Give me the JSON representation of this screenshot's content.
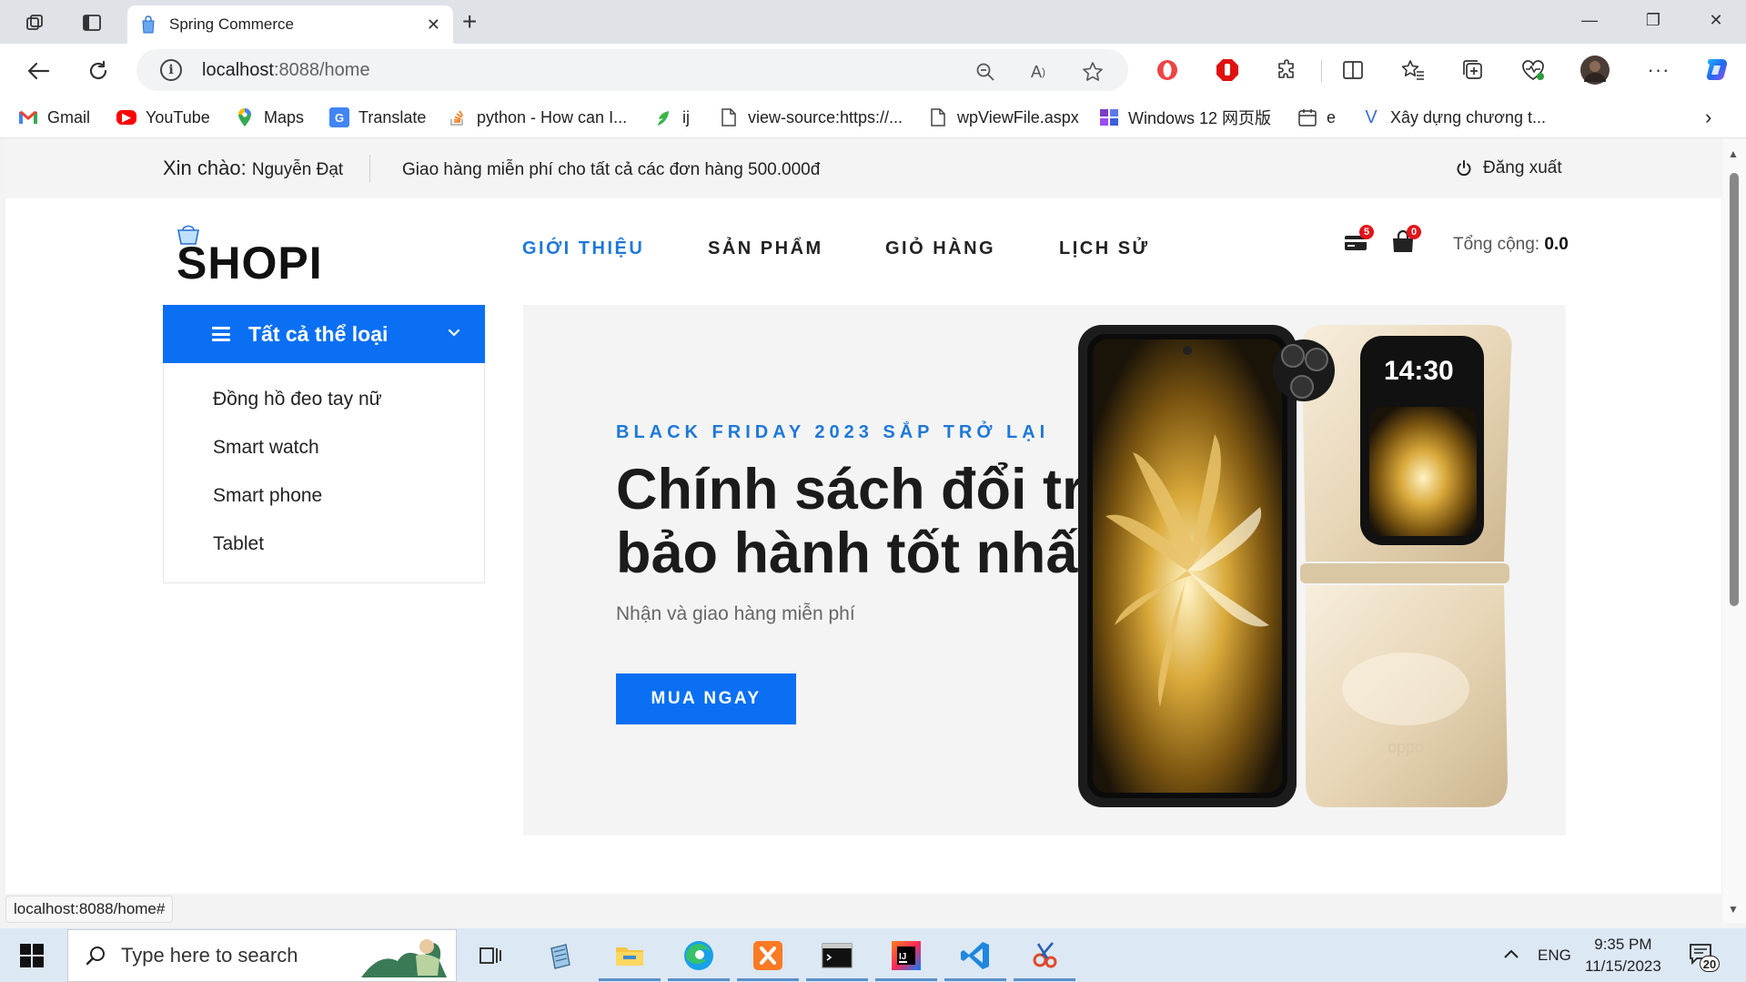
{
  "browser": {
    "tab": {
      "title": "Spring Commerce",
      "close_glyph": "✕"
    },
    "window_controls": {
      "minimize": "—",
      "maximize": "❐",
      "close": "✕"
    },
    "address": {
      "host": "localhost",
      "rest": ":8088/home"
    },
    "bookmarks": [
      {
        "label": "Gmail",
        "icon": "gmail-icon",
        "color": "#ea4335"
      },
      {
        "label": "YouTube",
        "icon": "youtube-icon",
        "color": "#ff0000"
      },
      {
        "label": "Maps",
        "icon": "maps-icon",
        "color": "#34a853"
      },
      {
        "label": "Translate",
        "icon": "translate-icon",
        "color": "#4285f4"
      },
      {
        "label": "python - How can I...",
        "icon": "stackoverflow-icon",
        "color": "#f48024"
      },
      {
        "label": "ij",
        "icon": "ij-icon",
        "color": "#3bb44a"
      },
      {
        "label": "view-source:https://...",
        "icon": "page-icon",
        "color": "#555555"
      },
      {
        "label": "wpViewFile.aspx",
        "icon": "page-icon",
        "color": "#555555"
      },
      {
        "label": "Windows 12 网页版",
        "icon": "windows12-icon",
        "color": "#7a3dc8"
      },
      {
        "label": "e",
        "icon": "calendar-icon",
        "color": "#555555"
      },
      {
        "label": "Xây dựng chương t...",
        "icon": "v-icon",
        "color": "#3b6fd6"
      }
    ]
  },
  "site": {
    "topbar": {
      "greeting_prefix": "Xin chào: ",
      "user_name": "Nguyễn Đạt",
      "shipping_note": "Giao hàng miễn phí cho tất cả các đơn hàng 500.000đ",
      "logout": "Đăng xuất"
    },
    "logo": "SHOPI",
    "nav": [
      {
        "label": "GIỚI THIỆU",
        "active": true
      },
      {
        "label": "SẢN PHẨM",
        "active": false
      },
      {
        "label": "GIỎ HÀNG",
        "active": false
      },
      {
        "label": "LỊCH SỬ",
        "active": false
      }
    ],
    "cart": {
      "card_count": "5",
      "bag_count": "0",
      "total_label": "Tổng cộng: ",
      "total_value": "0.0"
    },
    "categories": {
      "button": "Tất cả thể loại",
      "items": [
        "Đồng hồ đeo tay nữ",
        "Smart watch",
        "Smart phone",
        "Tablet"
      ]
    },
    "hero": {
      "eyebrow": "BLACK FRIDAY 2023 SẮP TRỞ LẠI",
      "headline_line1": "Chính sách đổi trả",
      "headline_line2": "bảo hành tốt nhất",
      "subtitle": "Nhận và giao hàng miễn phí",
      "cta": "MUA NGAY",
      "phone_screen_time": "14:30",
      "phone_brand": "oppo"
    }
  },
  "status_url": "localhost:8088/home#",
  "taskbar": {
    "search_placeholder": "Type here to search",
    "language": "ENG",
    "time": "9:35 PM",
    "date": "11/15/2023",
    "notification_count": "20"
  },
  "colors": {
    "accent": "#0a6ff3",
    "nav_active": "#1e78d8",
    "badge": "#e0151a"
  }
}
